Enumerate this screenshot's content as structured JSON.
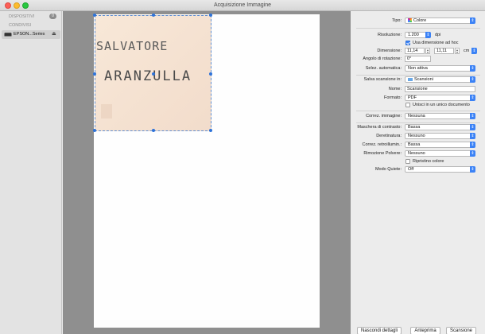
{
  "window": {
    "title": "Acquisizione Immagine"
  },
  "sidebar": {
    "devices_heading": "DISPOSITIVI",
    "devices_count": "0",
    "shared_heading": "CONDIVISI",
    "device_name": "EPSON...Series"
  },
  "preview": {
    "handwriting_line1": "SALVATORE",
    "handwriting_line2": "ARANZULLA"
  },
  "settings": {
    "tipo": {
      "label": "Tipo:",
      "value": "Colore"
    },
    "risoluzione": {
      "label": "Risoluzione:",
      "value": "1.200",
      "unit": "dpi"
    },
    "use_custom_size": {
      "label": "Usa dimensione ad hoc",
      "checked": true
    },
    "dimensione": {
      "label": "Dimensione:",
      "width": "11,14",
      "height": "11,11",
      "unit": "cm"
    },
    "rotazione": {
      "label": "Angolo di rotazione:",
      "value": "0°"
    },
    "selez_auto": {
      "label": "Selez. automatica:",
      "value": "Non attiva"
    },
    "salva_in": {
      "label": "Salva scansione in:",
      "value": "Scansioni"
    },
    "nome": {
      "label": "Nome:",
      "value": "Scansione"
    },
    "formato": {
      "label": "Formato:",
      "value": "PDF"
    },
    "unisci": {
      "label": "Unisci in un unico documento",
      "checked": false
    },
    "correz_immagine": {
      "label": "Correz. immagine:",
      "value": "Nessuna"
    },
    "maschera_contrasto": {
      "label": "Maschera di contrasto:",
      "value": "Bassa"
    },
    "deretinatura": {
      "label": "Deretinatura:",
      "value": "Nessuno"
    },
    "correz_retro": {
      "label": "Correz. retroillumin.:",
      "value": "Bassa"
    },
    "rimozione_polvere": {
      "label": "Rimozione Polvere:",
      "value": "Nessuno"
    },
    "ripristino_colore": {
      "label": "Ripristino colore",
      "checked": false
    },
    "modo_quiete": {
      "label": "Modo Quiete:",
      "value": "Off"
    }
  },
  "buttons": {
    "hide_details": "Nascondi dettagli",
    "preview": "Anteprima",
    "scan": "Scansione"
  },
  "colors": {
    "accent": "#3b82f6",
    "selection": "#f6e6d6"
  }
}
